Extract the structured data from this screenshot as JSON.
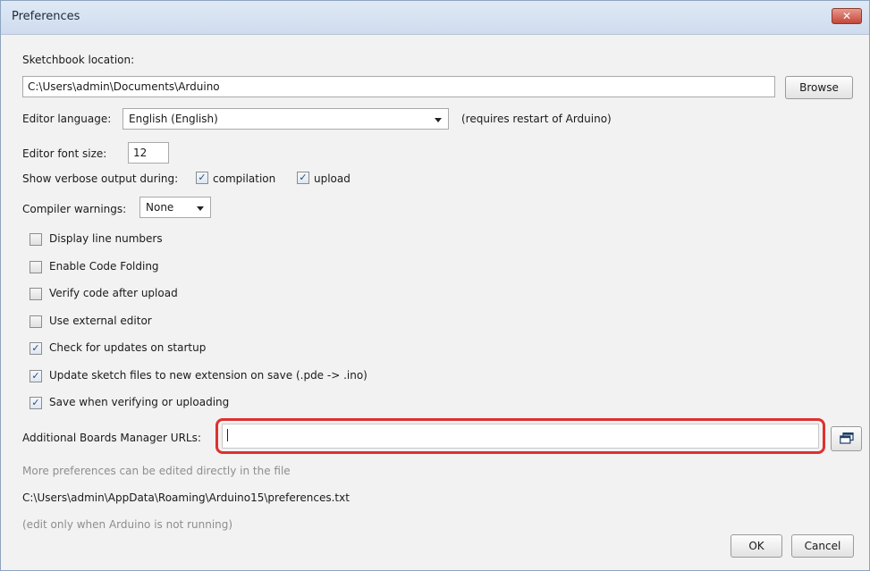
{
  "window": {
    "title": "Preferences",
    "close_glyph": "✕"
  },
  "sketchbook": {
    "label": "Sketchbook location:",
    "path": "C:\\Users\\admin\\Documents\\Arduino",
    "browse_label": "Browse"
  },
  "editor_language": {
    "label": "Editor language:",
    "value": "English (English)",
    "note": "(requires restart of Arduino)"
  },
  "editor_font_size": {
    "label": "Editor font size:",
    "value": "12"
  },
  "verbose": {
    "label": "Show verbose output during:",
    "compilation_label": "compilation",
    "compilation_checked": true,
    "upload_label": "upload",
    "upload_checked": true
  },
  "compiler_warnings": {
    "label": "Compiler warnings:",
    "value": "None"
  },
  "options": [
    {
      "label": "Display line numbers",
      "checked": false
    },
    {
      "label": "Enable Code Folding",
      "checked": false
    },
    {
      "label": "Verify code after upload",
      "checked": false
    },
    {
      "label": "Use external editor",
      "checked": false
    },
    {
      "label": "Check for updates on startup",
      "checked": true
    },
    {
      "label": "Update sketch files to new extension on save (.pde -> .ino)",
      "checked": true
    },
    {
      "label": "Save when verifying or uploading",
      "checked": true
    }
  ],
  "boards_manager": {
    "label": "Additional Boards Manager URLs:",
    "value": "",
    "icon": "window-list-icon",
    "highlight_color": "#e03030"
  },
  "footer": {
    "more_prefs_note": "More preferences can be edited directly in the file",
    "prefs_path": "C:\\Users\\admin\\AppData\\Roaming\\Arduino15\\preferences.txt",
    "edit_note": "(edit only when Arduino is not running)"
  },
  "buttons": {
    "ok_label": "OK",
    "cancel_label": "Cancel"
  },
  "check_glyph": "✓"
}
